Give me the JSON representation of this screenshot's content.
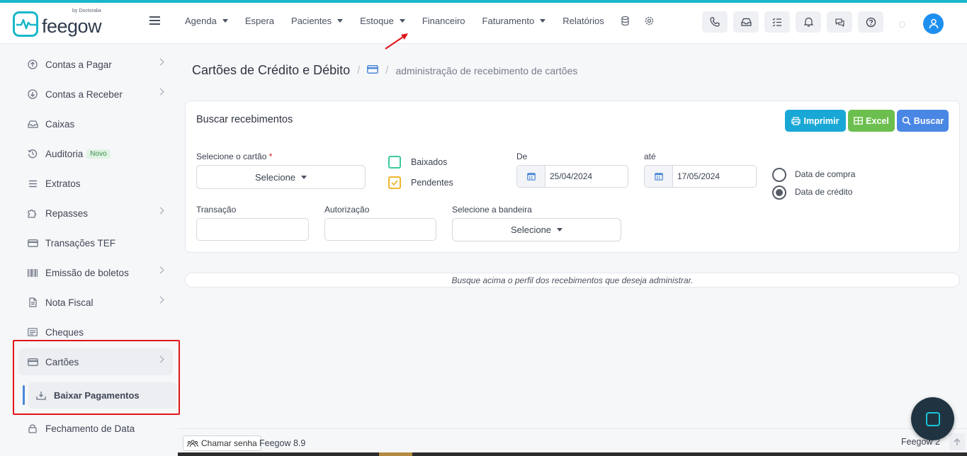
{
  "brand": {
    "name": "feegow",
    "sub": "by Doctoralia"
  },
  "nav": {
    "items": [
      {
        "label": "Agenda",
        "dropdown": true
      },
      {
        "label": "Espera",
        "dropdown": false
      },
      {
        "label": "Pacientes",
        "dropdown": true
      },
      {
        "label": "Estoque",
        "dropdown": true
      },
      {
        "label": "Financeiro",
        "dropdown": false
      },
      {
        "label": "Faturamento",
        "dropdown": true
      },
      {
        "label": "Relatórios",
        "dropdown": false
      }
    ],
    "icons": [
      "database-icon",
      "gear-icon"
    ]
  },
  "header_buttons": [
    "phone-icon",
    "inbox-icon",
    "checklist-icon",
    "bell-icon",
    "chat-icon",
    "help-icon"
  ],
  "sidebar": {
    "items": [
      {
        "label": "Contas a Pagar",
        "icon": "arrow-up-circle-icon",
        "chevron": true
      },
      {
        "label": "Contas a Receber",
        "icon": "arrow-down-circle-icon",
        "chevron": true
      },
      {
        "label": "Caixas",
        "icon": "inbox-icon",
        "chevron": false
      },
      {
        "label": "Auditoria",
        "icon": "history-icon",
        "chevron": false,
        "badge": "Novo"
      },
      {
        "label": "Extratos",
        "icon": "list-icon",
        "chevron": false
      },
      {
        "label": "Repasses",
        "icon": "puzzle-icon",
        "chevron": true
      },
      {
        "label": "Transações TEF",
        "icon": "card-icon",
        "chevron": false
      },
      {
        "label": "Emissão de boletos",
        "icon": "barcode-icon",
        "chevron": true
      },
      {
        "label": "Nota Fiscal",
        "icon": "document-icon",
        "chevron": true
      },
      {
        "label": "Cheques",
        "icon": "cheque-icon",
        "chevron": false
      },
      {
        "label": "Cartões",
        "icon": "card-icon",
        "chevron": true
      },
      {
        "label": "Baixar Pagamentos",
        "icon": "download-tray-icon",
        "chevron": false
      },
      {
        "label": "Fechamento de Data",
        "icon": "lock-icon",
        "chevron": false
      }
    ]
  },
  "breadcrumb": {
    "title": "Cartões de Crédito e Débito",
    "sub": "administração de recebimento de cartões"
  },
  "search_card": {
    "title": "Buscar recebimentos",
    "buttons": {
      "print": "Imprimir",
      "excel": "Excel",
      "search": "Buscar"
    },
    "card_select": {
      "label": "Selecione o cartão",
      "required": "*",
      "value": "Selecione"
    },
    "checks": [
      {
        "label": "Baixados",
        "checked": false,
        "color": "#3cc9a0"
      },
      {
        "label": "Pendentes",
        "checked": true,
        "color": "#f0b530"
      }
    ],
    "from": {
      "label": "De",
      "value": "25/04/2024"
    },
    "to": {
      "label": "até",
      "value": "17/05/2024"
    },
    "date_type": [
      {
        "label": "Data de compra",
        "selected": false
      },
      {
        "label": "Data de crédito",
        "selected": true
      }
    ],
    "transacao": {
      "label": "Transação",
      "value": ""
    },
    "autorizacao": {
      "label": "Autorização",
      "value": ""
    },
    "bandeira": {
      "label": "Selecione a bandeira",
      "value": "Selecione"
    }
  },
  "info": "Busque acima o perfil dos recebimentos que deseja administrar.",
  "footer": {
    "chamar": "Chamar senha",
    "version": "Feegow 8.9",
    "right": "Feegow 2"
  },
  "colors": {
    "accent": "#19b7c9",
    "print": "#19a8d6",
    "excel": "#6cbf4e",
    "search": "#4a86e4",
    "highlight": "#e0161a"
  }
}
